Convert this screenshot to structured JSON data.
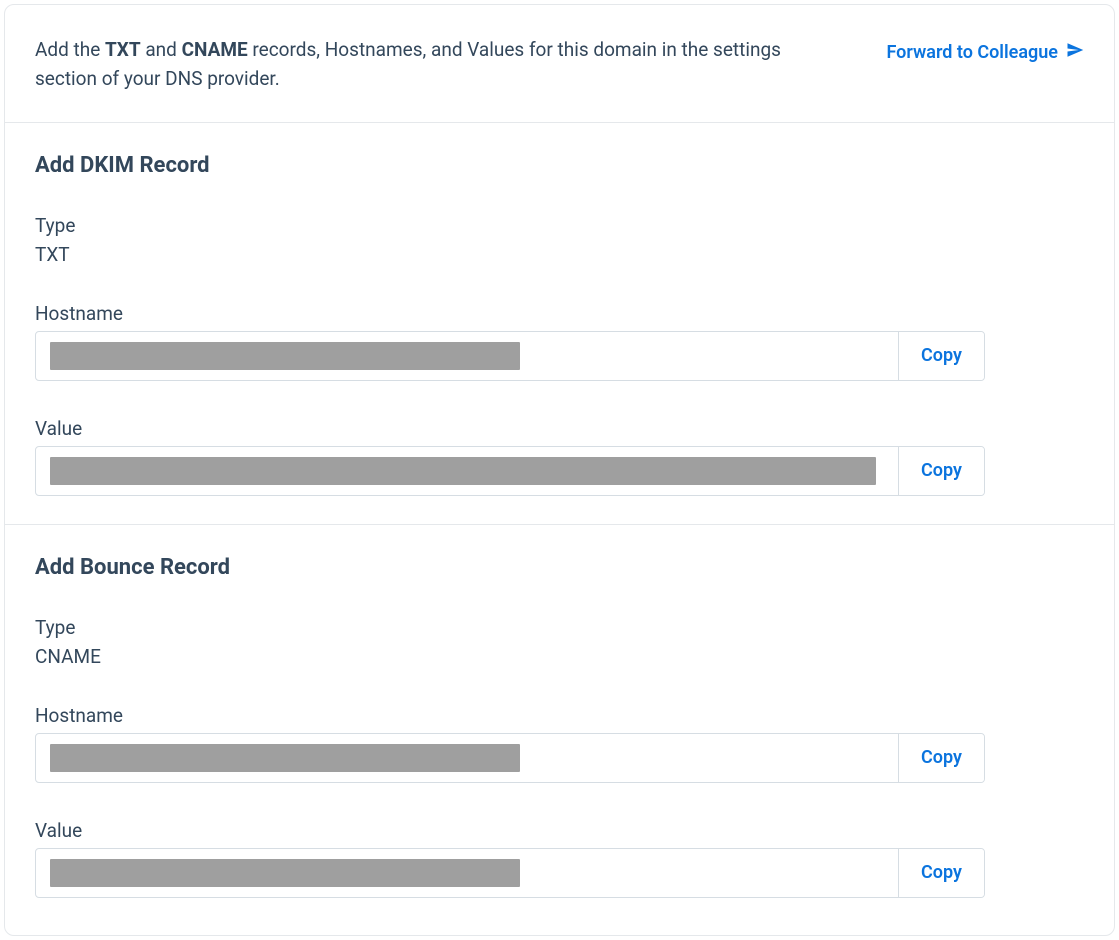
{
  "header": {
    "instruction_pre": "Add the ",
    "instruction_b1": "TXT",
    "instruction_mid1": " and ",
    "instruction_b2": "CNAME",
    "instruction_post": " records, Hostnames, and Values for this domain in the settings section of your DNS provider.",
    "forward_label": "Forward to Colleague"
  },
  "sections": {
    "dkim": {
      "title": "Add DKIM Record",
      "type_label": "Type",
      "type_value": "TXT",
      "hostname_label": "Hostname",
      "hostname_copy": "Copy",
      "value_label": "Value",
      "value_copy": "Copy"
    },
    "bounce": {
      "title": "Add Bounce Record",
      "type_label": "Type",
      "type_value": "CNAME",
      "hostname_label": "Hostname",
      "hostname_copy": "Copy",
      "value_label": "Value",
      "value_copy": "Copy"
    }
  }
}
